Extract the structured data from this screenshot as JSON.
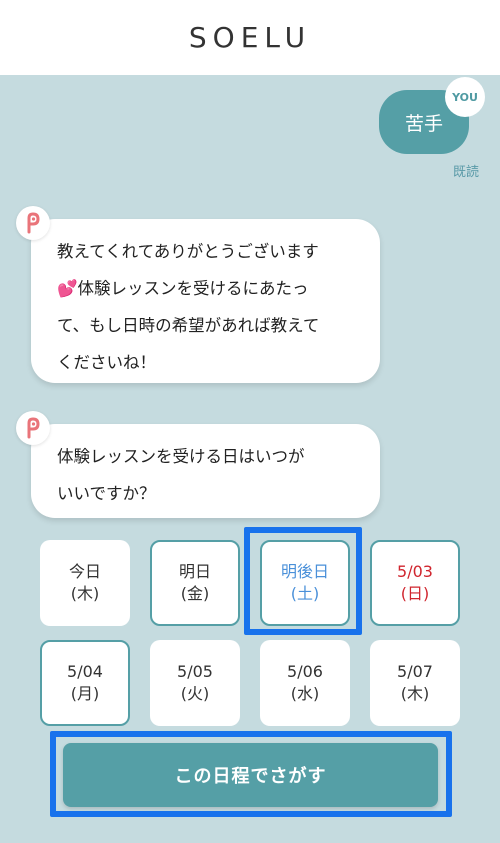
{
  "header": {
    "logo": "SOELU"
  },
  "user_message": {
    "text": "苦手",
    "badge": "YOU",
    "read_status": "既読"
  },
  "bot_messages": [
    {
      "lines": [
        "教えてくれてありがとうございます",
        "💕体験レッスンを受けるにあたっ",
        "て、もし日時の希望があれば教えて",
        "くださいね！"
      ]
    },
    {
      "lines": [
        "体験レッスンを受ける日はいつが",
        "いいですか？"
      ]
    }
  ],
  "dates": [
    {
      "date": "今日",
      "weekday": "(木)"
    },
    {
      "date": "明日",
      "weekday": "(金)"
    },
    {
      "date": "明後日",
      "weekday": "(土)"
    },
    {
      "date": "5/03",
      "weekday": "(日)"
    },
    {
      "date": "5/04",
      "weekday": "(月)"
    },
    {
      "date": "5/05",
      "weekday": "(火)"
    },
    {
      "date": "5/06",
      "weekday": "(水)"
    },
    {
      "date": "5/07",
      "weekday": "(木)"
    }
  ],
  "search_button": {
    "label": "この日程でさがす"
  },
  "colors": {
    "background": "#c5dbdf",
    "accent": "#559fa6",
    "sunday": "#d0252e",
    "selected_text": "#4a90d9",
    "highlight": "#1872ec"
  }
}
